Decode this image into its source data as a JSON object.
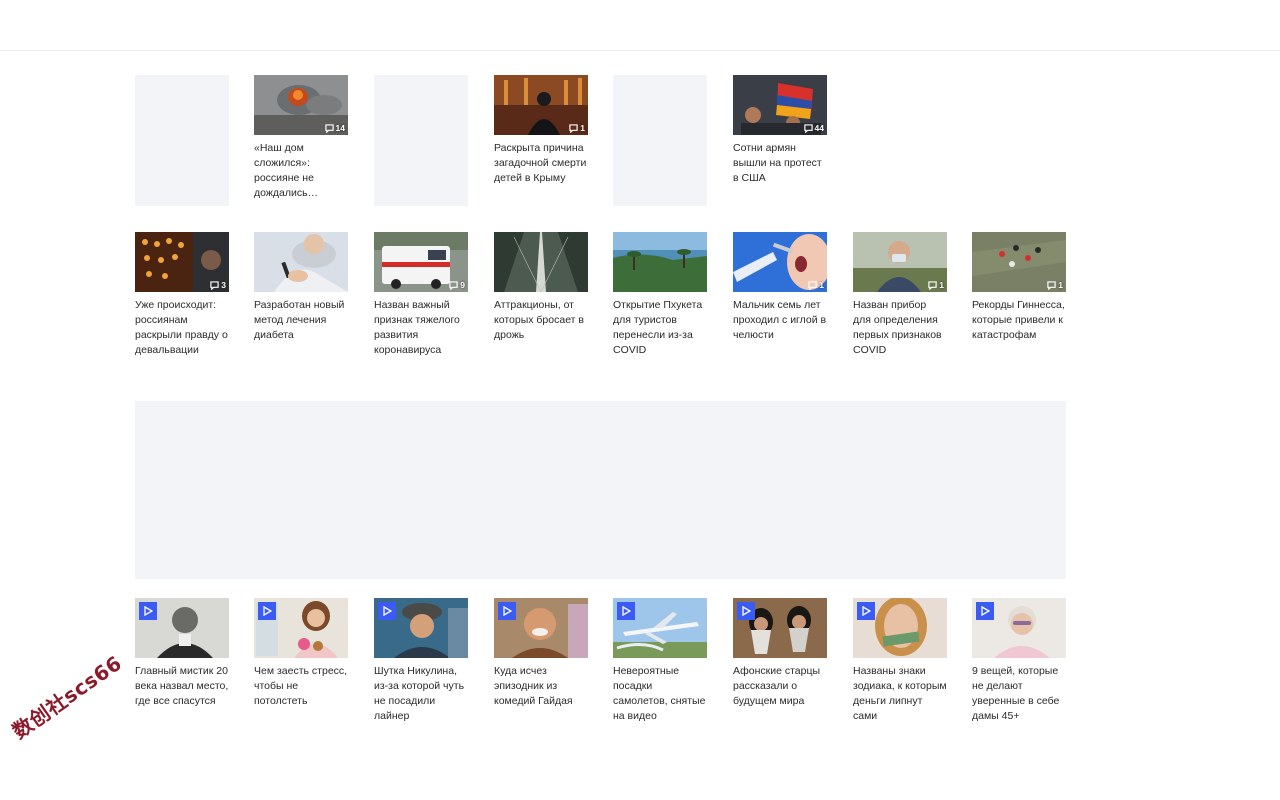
{
  "row1": [
    {
      "type": "placeholder"
    },
    {
      "type": "article",
      "caption": "«Наш дом сложился»: россияне не дождались…",
      "comments": "14"
    },
    {
      "type": "placeholder"
    },
    {
      "type": "article",
      "caption": "Раскрыта причина загадочной смерти детей в Крыму",
      "comments": "1"
    },
    {
      "type": "placeholder"
    },
    {
      "type": "article",
      "caption": "Сотни армян вышли на протест в США",
      "comments": "44"
    }
  ],
  "row2": [
    {
      "caption": "Уже происходит: россиянам раскрыли правду о девальвации",
      "comments": "3"
    },
    {
      "caption": "Разработан новый метод лечения диабета",
      "comments": ""
    },
    {
      "caption": "Назван важный признак тяжелого развития коронавируса",
      "comments": "9"
    },
    {
      "caption": "Аттракционы, от которых бросает в дрожь",
      "comments": ""
    },
    {
      "caption": "Открытие Пхукета для туристов перенесли из-за COVID",
      "comments": ""
    },
    {
      "caption": "Мальчик семь лет проходил с иглой в челюсти",
      "comments": "1"
    },
    {
      "caption": "Назван прибор для определения первых признаков COVID",
      "comments": "1"
    },
    {
      "caption": "Рекорды Гиннесса, которые привели к катастрофам",
      "comments": "1"
    }
  ],
  "row3": [
    {
      "caption": "Главный мистик 20 века назвал место, где все спасутся"
    },
    {
      "caption": "Чем заесть стресс, чтобы не потолстеть"
    },
    {
      "caption": "Шутка Никулина, из-за которой чуть не посадили лайнер"
    },
    {
      "caption": "Куда исчез эпизодник из комедий Гайдая"
    },
    {
      "caption": "Невероятные посадки самолетов, снятые на видео"
    },
    {
      "caption": "Афонские старцы рассказали о будущем мира"
    },
    {
      "caption": "Названы знаки зодиака, к которым деньги липнут сами"
    },
    {
      "caption": "9 вещей, которые не делают уверенные в себе дамы 45+"
    }
  ],
  "watermark": "数创社scs66",
  "colors": {
    "placeholder": "#f3f4f7",
    "play_badge": "#3b5bf5",
    "caption_text": "#2b2b2b",
    "watermark": "#8b1a2a"
  },
  "icons": {
    "comment": "comment-bubble-icon",
    "video": "play-icon"
  }
}
